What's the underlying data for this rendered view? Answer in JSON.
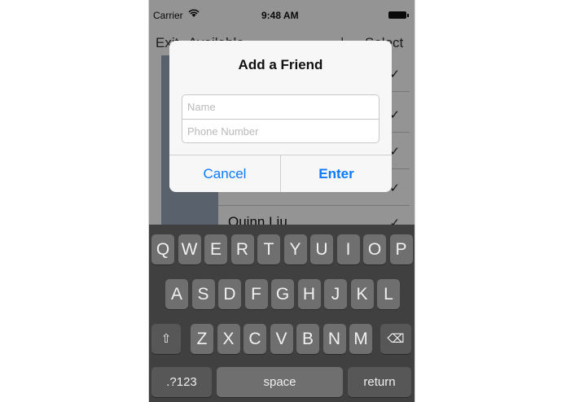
{
  "status": {
    "carrier": "Carrier",
    "wifi_icon": "wifi-icon",
    "time": "9:48 AM",
    "battery_icon": "battery-icon"
  },
  "nav": {
    "left": "Exit",
    "title": "Available",
    "separator": "|",
    "right": "Select"
  },
  "contacts": [
    {
      "name": "",
      "check": "✓"
    },
    {
      "name": "",
      "check": "✓"
    },
    {
      "name": "",
      "check": "✓"
    },
    {
      "name": "",
      "check": "✓"
    },
    {
      "name": "Quinn Liu",
      "check": "✓"
    }
  ],
  "alert": {
    "title": "Add a Friend",
    "name_placeholder": "Name",
    "name_value": "",
    "phone_placeholder": "Phone Number",
    "phone_value": "",
    "cancel_label": "Cancel",
    "enter_label": "Enter",
    "button_color": "#0a7aff"
  },
  "keyboard": {
    "row1": [
      "Q",
      "W",
      "E",
      "R",
      "T",
      "Y",
      "U",
      "I",
      "O",
      "P"
    ],
    "row2": [
      "A",
      "S",
      "D",
      "F",
      "G",
      "H",
      "J",
      "K",
      "L"
    ],
    "row3": [
      "Z",
      "X",
      "C",
      "V",
      "B",
      "N",
      "M"
    ],
    "shift_icon": "shift-icon",
    "shift_glyph": "⇧",
    "delete_icon": "delete-icon",
    "delete_glyph": "⌫",
    "numbers_label": ".?123",
    "space_label": "space",
    "return_label": "return"
  }
}
